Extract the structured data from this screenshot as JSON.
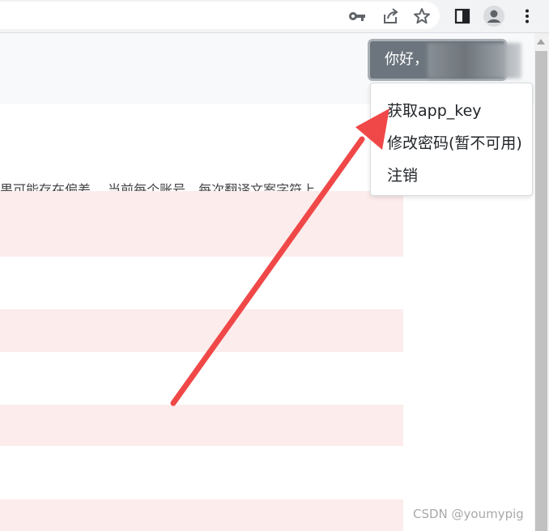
{
  "browser": {
    "icons": [
      "key-icon",
      "share-icon",
      "star-icon",
      "side-panel-icon",
      "profile-icon",
      "more-icon"
    ]
  },
  "header": {
    "greeting": "你好，"
  },
  "notice": {
    "text": "果可能存在偏差。 当前每个账号，每次翻译文案字符上"
  },
  "menu": {
    "items": [
      {
        "label": "获取app_key"
      },
      {
        "label": "修改密码(暂不可用)"
      },
      {
        "label": "注销"
      }
    ]
  },
  "watermark": "CSDN @youmypig",
  "colors": {
    "button": "#6c757d",
    "stripe": "#fdecec",
    "arrow": "#f04848"
  }
}
